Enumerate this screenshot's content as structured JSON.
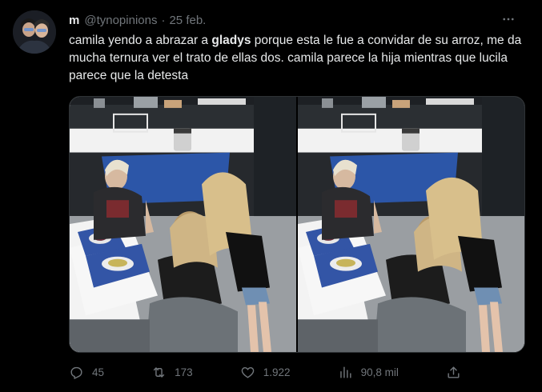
{
  "author": {
    "display_name": "m",
    "handle": "@tynopinions",
    "separator": "·",
    "date": "25 feb."
  },
  "tweet": {
    "text_before": "camila yendo a abrazar a ",
    "text_bold": "gladys",
    "text_after": " porque esta le fue a convidar de su arroz, me da mucha ternura ver el trato de ellas dos. camila parece la hija mientras que lucila parece que la detesta"
  },
  "actions": {
    "reply_count": "45",
    "retweet_count": "173",
    "like_count": "1.922",
    "views_count": "90,8 mil"
  },
  "icons": {
    "more": "more-icon",
    "reply": "reply-icon",
    "retweet": "retweet-icon",
    "like": "heart-icon",
    "views": "views-icon",
    "share": "share-icon"
  },
  "colors": {
    "background": "#000000",
    "text": "#e7e9ea",
    "muted": "#71767b",
    "border": "#2f3336"
  }
}
